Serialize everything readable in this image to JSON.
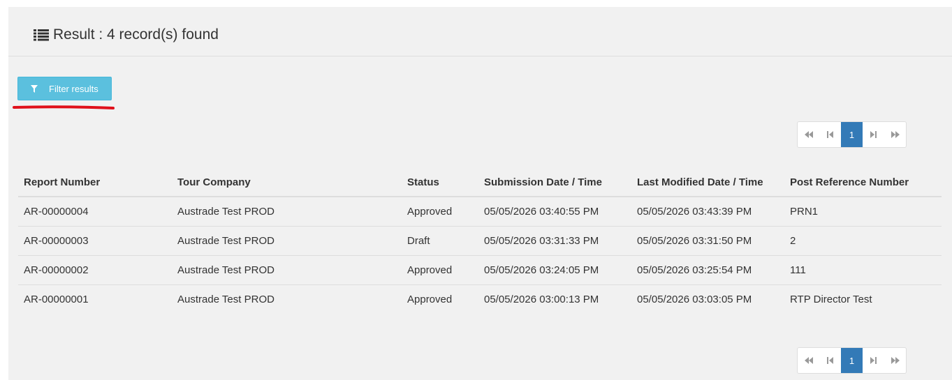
{
  "header": {
    "title": "Result : 4 record(s) found",
    "icon": "list-icon"
  },
  "filter_button": {
    "label": "Filter results",
    "icon": "filter-icon",
    "color": "#5bc0de"
  },
  "pagination": {
    "first": "first-page-icon",
    "prev": "previous-page-icon",
    "current": "1",
    "next": "next-page-icon",
    "last": "last-page-icon",
    "active_color": "#337ab7"
  },
  "table": {
    "columns": [
      "Report Number",
      "Tour Company",
      "Status",
      "Submission Date / Time",
      "Last Modified Date / Time",
      "Post Reference Number"
    ],
    "rows": [
      [
        "AR-00000004",
        "Austrade Test PROD",
        "Approved",
        "05/05/2026 03:40:55 PM",
        "05/05/2026 03:43:39 PM",
        "PRN1"
      ],
      [
        "AR-00000003",
        "Austrade Test PROD",
        "Draft",
        "05/05/2026 03:31:33 PM",
        "05/05/2026 03:31:50 PM",
        "2"
      ],
      [
        "AR-00000002",
        "Austrade Test PROD",
        "Approved",
        "05/05/2026 03:24:05 PM",
        "05/05/2026 03:25:54 PM",
        "111"
      ],
      [
        "AR-00000001",
        "Austrade Test PROD",
        "Approved",
        "05/05/2026 03:00:13 PM",
        "05/05/2026 03:03:05 PM",
        "RTP Director Test"
      ]
    ]
  },
  "annotation_color": "#e0101a"
}
